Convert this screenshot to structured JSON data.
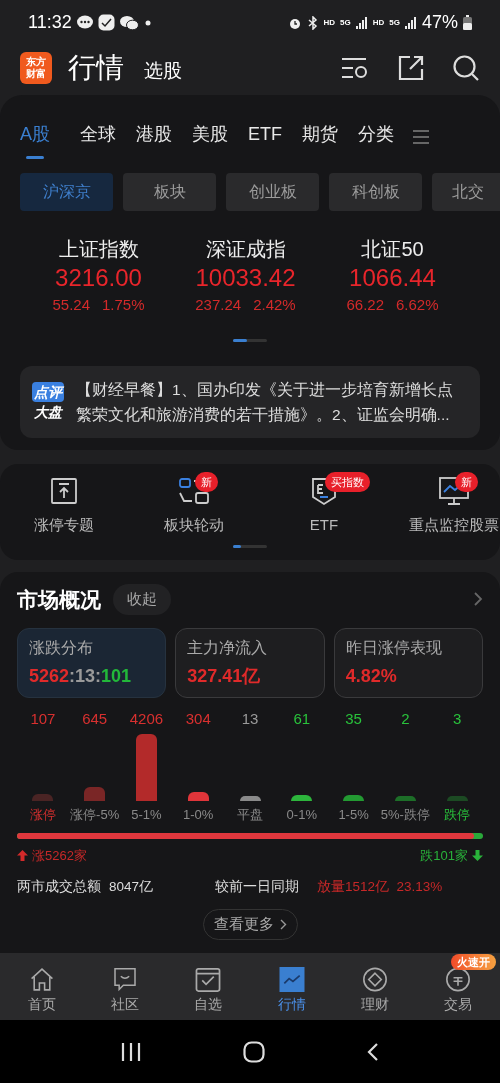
{
  "status_bar": {
    "time": "11:32",
    "right_texts": [
      "HD",
      "5G",
      "HD",
      "5G"
    ],
    "battery": "47%"
  },
  "header": {
    "logo": [
      "东方",
      "财富"
    ],
    "title": "行情",
    "subtitle": "选股"
  },
  "tabs": [
    {
      "label": "A股",
      "selected": true
    },
    {
      "label": "全球",
      "selected": false
    },
    {
      "label": "港股",
      "selected": false
    },
    {
      "label": "美股",
      "selected": false
    },
    {
      "label": "ETF",
      "selected": false
    },
    {
      "label": "期货",
      "selected": false
    },
    {
      "label": "分类",
      "selected": false
    }
  ],
  "sub_tabs": [
    {
      "label": "沪深京",
      "selected": true
    },
    {
      "label": "板块",
      "selected": false
    },
    {
      "label": "创业板",
      "selected": false
    },
    {
      "label": "科创板",
      "selected": false
    },
    {
      "label": "北交",
      "selected": false
    }
  ],
  "indices": [
    {
      "name": "上证指数",
      "value": "3216.00",
      "change": "55.24",
      "percent": "1.75%"
    },
    {
      "name": "深证成指",
      "value": "10033.42",
      "change": "237.24",
      "percent": "2.42%"
    },
    {
      "name": "北证50",
      "value": "1066.44",
      "change": "66.22",
      "percent": "6.62%"
    }
  ],
  "news": {
    "badge": [
      "点评",
      "大盘"
    ],
    "text": "【财经早餐】1、国办印发《关于进一步培育新增长点繁荣文化和旅游消费的若干措施》。2、证监会明确..."
  },
  "shortcuts": [
    {
      "label": "涨停专题",
      "kind": "upload"
    },
    {
      "label": "板块轮动",
      "kind": "rotate",
      "badge": "新"
    },
    {
      "label": "ETF",
      "kind": "etf",
      "badge": "买指数"
    },
    {
      "label": "重点监控股票",
      "kind": "monitor",
      "badge": "新"
    }
  ],
  "market": {
    "title": "市场概况",
    "collapse": "收起",
    "stats": [
      {
        "label": "涨跌分布",
        "selected": true,
        "parts": [
          {
            "text": "5262",
            "color": "#e02a2a"
          },
          {
            "text": ":13:",
            "color": "#9a9a9a"
          },
          {
            "text": "101",
            "color": "#22b83a"
          }
        ]
      },
      {
        "label": "主力净流入",
        "selected": false,
        "parts": [
          {
            "text": "327.41亿",
            "color": "#e02a2a"
          }
        ]
      },
      {
        "label": "昨日涨停表现",
        "selected": false,
        "parts": [
          {
            "text": "4.82%",
            "color": "#e02a2a"
          }
        ]
      }
    ],
    "distribution": [
      {
        "count": "107",
        "label": "涨停",
        "kind": "up",
        "highlight": true,
        "color": "#4a2424"
      },
      {
        "count": "645",
        "label": "涨停-5%",
        "kind": "up",
        "highlight": false,
        "color": "#7a2626"
      },
      {
        "count": "4206",
        "label": "5-1%",
        "kind": "up",
        "highlight": false,
        "color": "#b32a2a"
      },
      {
        "count": "304",
        "label": "1-0%",
        "kind": "up",
        "highlight": false,
        "color": "#e0353a"
      },
      {
        "count": "13",
        "label": "平盘",
        "kind": "flat",
        "highlight": false,
        "color": "#8a8a8a"
      },
      {
        "count": "61",
        "label": "0-1%",
        "kind": "down",
        "highlight": false,
        "color": "#2db53c"
      },
      {
        "count": "35",
        "label": "1-5%",
        "kind": "down",
        "highlight": false,
        "color": "#239a32"
      },
      {
        "count": "2",
        "label": "5%-跌停",
        "kind": "down",
        "highlight": false,
        "color": "#1d6e28"
      },
      {
        "count": "3",
        "label": "跌停",
        "kind": "down",
        "highlight": true,
        "color": "#1c4a23"
      }
    ],
    "ratio": {
      "level": 0.98,
      "up": "涨5262家",
      "down": "跌101家"
    },
    "turnover_label": "两市成交总额",
    "turnover": "8047亿",
    "compare_label": "较前一日同期",
    "compare": "放量1512亿  23.13%",
    "more": "查看更多"
  },
  "bottom_nav": [
    {
      "label": "首页",
      "selected": false,
      "kind": "home"
    },
    {
      "label": "社区",
      "selected": false,
      "kind": "chat"
    },
    {
      "label": "自选",
      "selected": false,
      "kind": "check"
    },
    {
      "label": "行情",
      "selected": true,
      "kind": "chart"
    },
    {
      "label": "理财",
      "selected": false,
      "kind": "diamond"
    },
    {
      "label": "交易",
      "selected": false,
      "kind": "yen",
      "badge": "火速开"
    }
  ]
}
